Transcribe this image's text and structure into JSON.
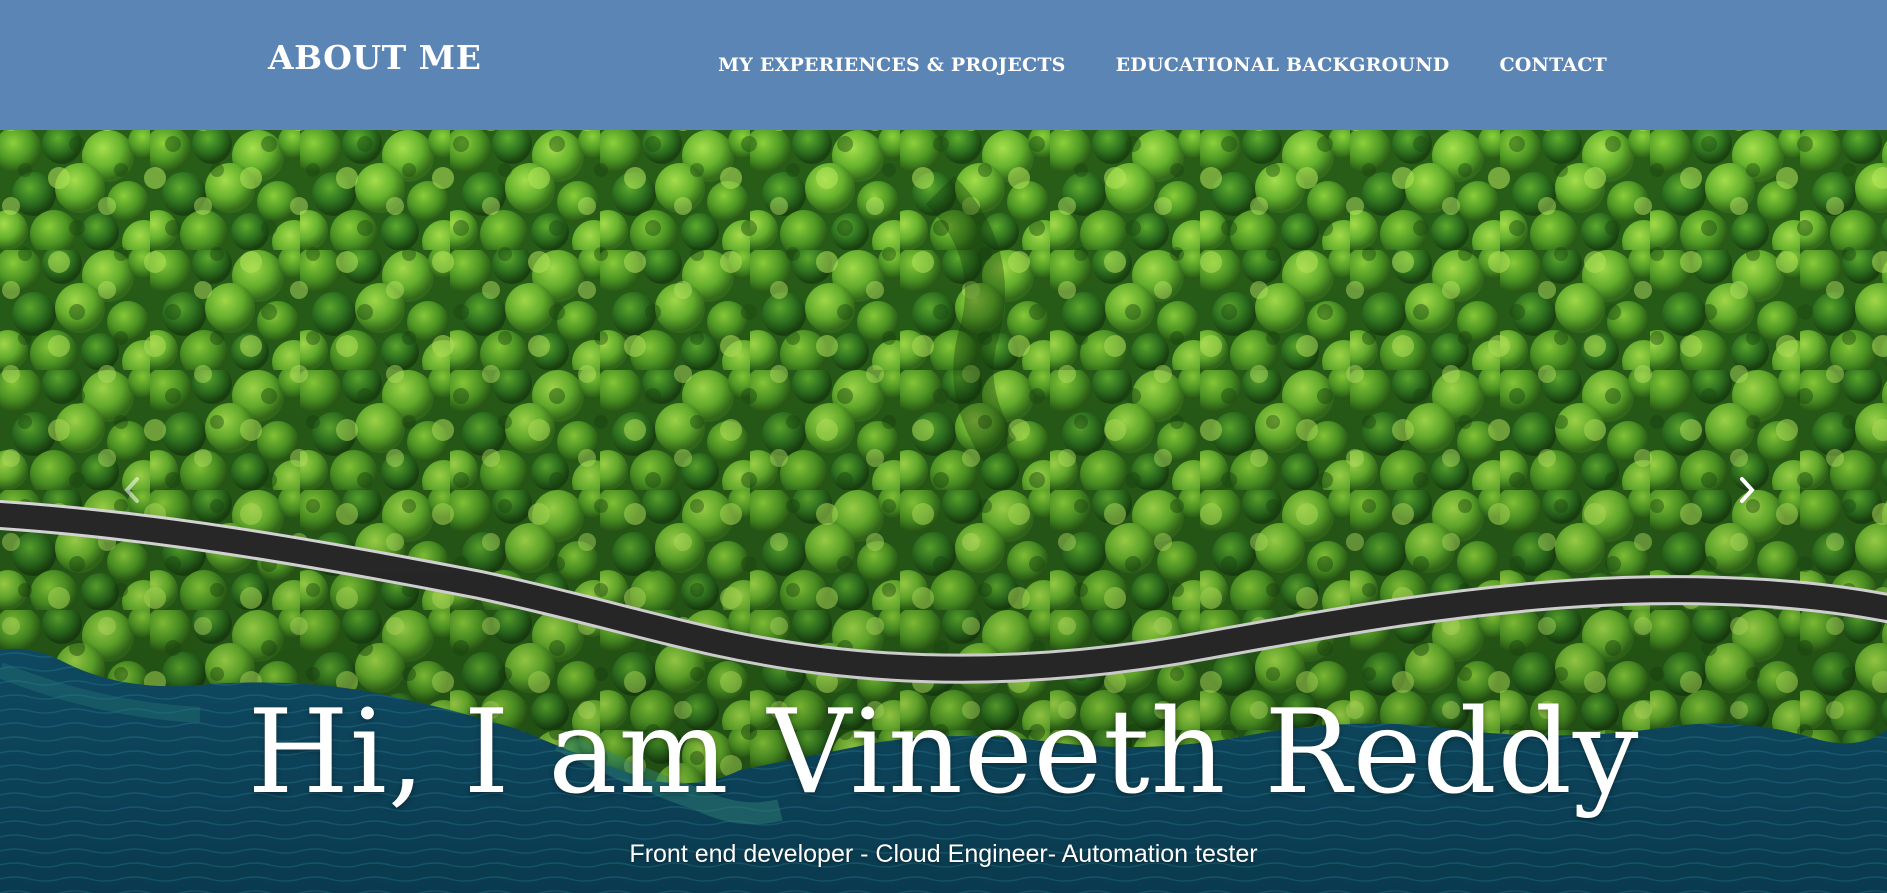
{
  "navbar": {
    "brand": "ABOUT ME",
    "links": [
      {
        "label": "MY EXPERIENCES & PROJECTS"
      },
      {
        "label": "EDUCATIONAL BACKGROUND"
      },
      {
        "label": "CONTACT"
      }
    ]
  },
  "hero": {
    "title": "Hi, I am Vineeth Reddy",
    "subtitle": "Front end developer - Cloud Engineer- Automation tester",
    "controls": {
      "prev_icon": "chevron-left-icon",
      "next_icon": "chevron-right-icon"
    }
  },
  "colors": {
    "navbar_bg": "#5b85b5",
    "forest": "#2f6a1c",
    "water": "#14607d",
    "road": "#2a2a2a"
  }
}
